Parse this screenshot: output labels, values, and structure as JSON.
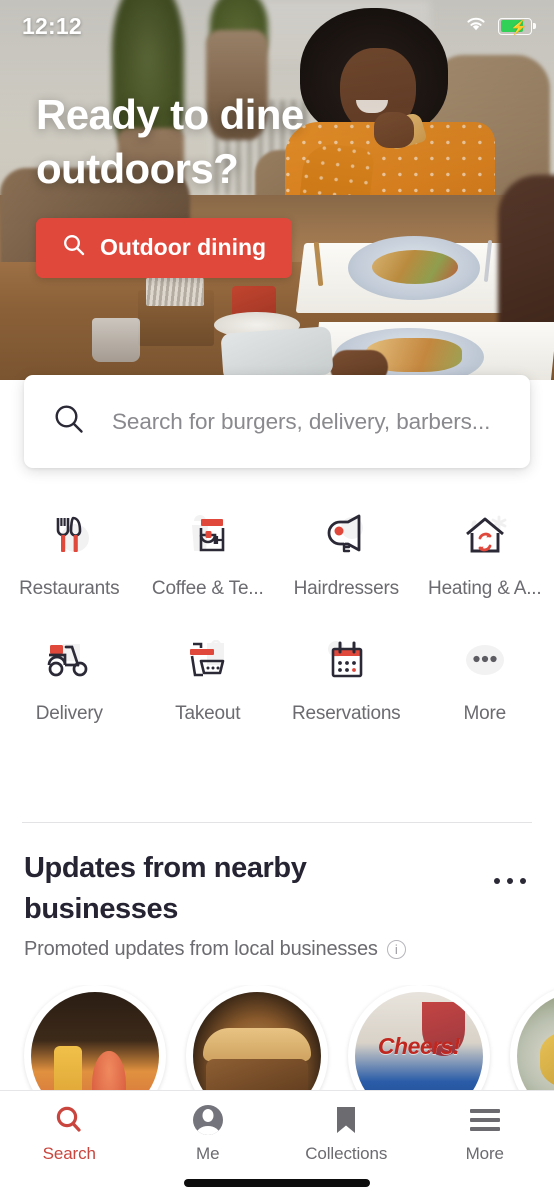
{
  "status_bar": {
    "time": "12:12",
    "wifi_icon": "wifi-icon",
    "battery_icon": "battery-charging-icon"
  },
  "hero": {
    "title": "Ready to dine outdoors?",
    "cta_label": "Outdoor dining",
    "cta_icon": "search-icon",
    "cta_color": "#E0483C"
  },
  "search": {
    "placeholder": "Search for burgers, delivery, barbers...",
    "icon": "search-icon"
  },
  "categories": [
    {
      "label": "Restaurants",
      "icon": "fork-knife-icon"
    },
    {
      "label": "Coffee & Te...",
      "icon": "coffee-cup-icon"
    },
    {
      "label": "Hairdressers",
      "icon": "hair-dryer-icon"
    },
    {
      "label": "Heating & A...",
      "icon": "house-hvac-icon"
    },
    {
      "label": "Delivery",
      "icon": "scooter-icon"
    },
    {
      "label": "Takeout",
      "icon": "takeout-box-icon"
    },
    {
      "label": "Reservations",
      "icon": "calendar-icon"
    },
    {
      "label": "More",
      "icon": "ellipsis-icon"
    }
  ],
  "updates": {
    "title": "Updates from nearby businesses",
    "subtitle": "Promoted updates from local businesses",
    "info_icon": "info-icon",
    "overflow_icon": "kebab-menu-icon",
    "stories": [
      {
        "name": "cocktails-photo"
      },
      {
        "name": "sandwich-photo"
      },
      {
        "name": "cheers-promo-flyer",
        "caption": "Cheers!"
      },
      {
        "name": "food-plate-photo"
      }
    ]
  },
  "bottom_nav": {
    "active_color": "#C9453D",
    "items": [
      {
        "label": "Search",
        "icon": "search-icon",
        "active": true
      },
      {
        "label": "Me",
        "icon": "avatar-icon",
        "active": false
      },
      {
        "label": "Collections",
        "icon": "bookmark-icon",
        "active": false
      },
      {
        "label": "More",
        "icon": "hamburger-icon",
        "active": false
      }
    ]
  }
}
